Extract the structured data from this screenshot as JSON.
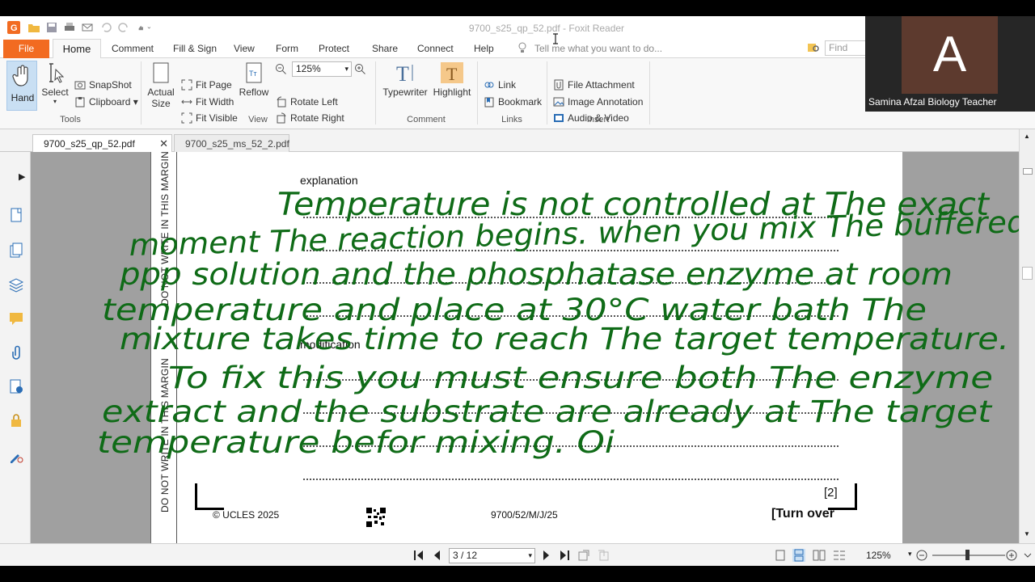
{
  "window": {
    "title": "9700_s25_qp_52.pdf - Foxit Reader"
  },
  "menu": {
    "file": "File",
    "items": [
      "Home",
      "Comment",
      "Fill & Sign",
      "View",
      "Form",
      "Protect",
      "Share",
      "Connect",
      "Help"
    ],
    "tell_me": "Tell me what you want to do...",
    "find_placeholder": "Find"
  },
  "ribbon": {
    "tools": {
      "hand": "Hand",
      "select": "Select",
      "snapshot": "SnapShot",
      "clipboard": "Clipboard",
      "group": "Tools"
    },
    "view": {
      "actual_size_1": "Actual",
      "actual_size_2": "Size",
      "fit_page": "Fit Page",
      "fit_width": "Fit Width",
      "fit_visible": "Fit Visible",
      "reflow": "Reflow",
      "zoom": "125%",
      "rotate_left": "Rotate Left",
      "rotate_right": "Rotate Right",
      "group": "View"
    },
    "comment": {
      "typewriter": "Typewriter",
      "highlight": "Highlight",
      "group": "Comment"
    },
    "links": {
      "link": "Link",
      "bookmark": "Bookmark",
      "group": "Links"
    },
    "insert": {
      "file_attachment": "File Attachment",
      "image_annotation": "Image Annotation",
      "audio_video": "Audio & Video",
      "group": "Insert"
    }
  },
  "tabs": [
    "9700_s25_qp_52.pdf",
    "9700_s25_ms_52_2.pdf"
  ],
  "document": {
    "margin_text": "DO NOT WRITE IN THIS MARGIN",
    "explanation_label": "explanation",
    "modification_label": "modification",
    "marks": "[2]",
    "copyright": "© UCLES 2025",
    "paper_code": "9700/52/M/J/25",
    "turn_over": "[Turn over",
    "handwriting": [
      "Temperature is not controlled at The exact",
      "moment The reaction begins. when you mix The buffered",
      "ppp solution and the phosphatase enzyme at room",
      "temperature and place at 30°C water bath The",
      "mixture takes time to reach The target temperature.",
      "To fix this you must ensure both The enzyme",
      "extract and the substrate are already at The target",
      "temperature befor mixing. Oi"
    ]
  },
  "status": {
    "page": "3 / 12",
    "zoom": "125%"
  },
  "webcam": {
    "initial": "A",
    "name": "Samina Afzal Biology Teacher"
  },
  "colors": {
    "accent": "#f26b21",
    "ink": "#0f6b17"
  }
}
